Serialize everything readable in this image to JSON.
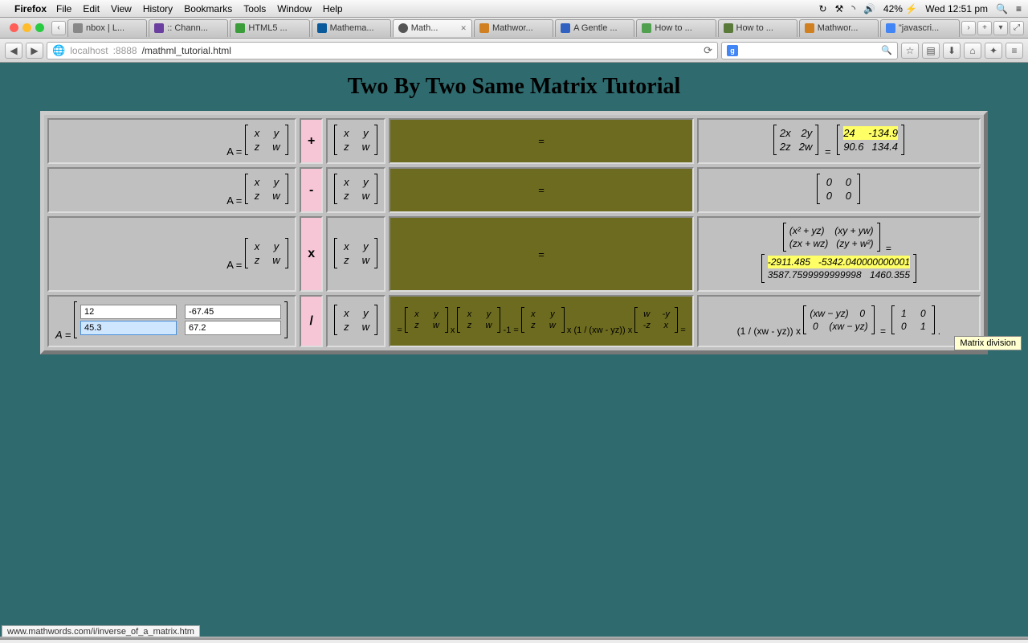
{
  "menubar": {
    "app": "Firefox",
    "items": [
      "File",
      "Edit",
      "View",
      "History",
      "Bookmarks",
      "Tools",
      "Window",
      "Help"
    ],
    "battery": "42%",
    "clock": "Wed 12:51 pm"
  },
  "tabs": [
    {
      "label": "nbox | L..."
    },
    {
      "label": ":: Chann..."
    },
    {
      "label": "HTML5 ..."
    },
    {
      "label": "Mathema..."
    },
    {
      "label": "Math...",
      "active": true
    },
    {
      "label": "Mathwor..."
    },
    {
      "label": "A Gentle ..."
    },
    {
      "label": "How to ..."
    },
    {
      "label": "How to ..."
    },
    {
      "label": "Mathwor..."
    },
    {
      "label": "\"javascri..."
    }
  ],
  "url": {
    "host": "localhost",
    "port": ":8888",
    "path": "/mathml_tutorial.html"
  },
  "page_title": "Two By Two Same Matrix Tutorial",
  "inputs": {
    "a": "12",
    "b": "-67.45",
    "c": "45.3",
    "d": "67.2"
  },
  "matrix_vars": {
    "r1c1": "x",
    "r1c2": "y",
    "r2c1": "z",
    "r2c2": "w"
  },
  "ops": {
    "add": "+",
    "sub": "-",
    "mul": "x",
    "div": "/"
  },
  "equals": "=",
  "A_label": "A =",
  "row1": {
    "left_expr": {
      "r1c1": "2x",
      "r1c2": "2y",
      "r2c1": "2z",
      "r2c2": "2w"
    },
    "result": {
      "r1c1": "24",
      "r1c2": "-134.9",
      "r2c1": "90.6",
      "r2c2": "134.4"
    }
  },
  "row2": {
    "result": {
      "r1c1": "0",
      "r1c2": "0",
      "r2c1": "0",
      "r2c2": "0"
    }
  },
  "row3": {
    "left_expr": {
      "r1c1": "(x² + yz)",
      "r1c2": "(xy + yw)",
      "r2c1": "(zx + wz)",
      "r2c2": "(zy + w²)"
    },
    "result": {
      "r1c1": "-2911.485",
      "r1c2": "-5342.040000000001",
      "r2c1": "3587.7599999999998",
      "r2c2": "1460.355"
    }
  },
  "row4": {
    "mid_prefix": "=",
    "mid_text1": "x",
    "mid_text2": "-1 =",
    "mid_text3": "x (1 / (xw - yz)) x",
    "mid_text4": "=",
    "right_prefix": "(1 / (xw - yz))  x",
    "right_expr": {
      "r1c1": "(xw − yz)",
      "r1c2": "0",
      "r2c1": "0",
      "r2c2": "(xw − yz)"
    },
    "final": {
      "r1c1": "1",
      "r1c2": "0",
      "r2c1": "0",
      "r2c2": "1"
    },
    "adj": {
      "r1c1": "w",
      "r1c2": "-y",
      "r2c1": "-z",
      "r2c2": "x"
    },
    "dot": "."
  },
  "tooltip": "Matrix division",
  "status_url": "www.mathwords.com/i/inverse_of_a_matrix.htm"
}
